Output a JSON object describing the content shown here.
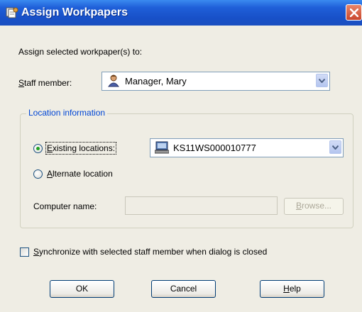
{
  "window": {
    "title": "Assign Workpapers",
    "icons": {
      "title": "workpapers-icon",
      "close": "close-icon"
    },
    "colors": {
      "titlebar": "#1f5fd8",
      "close": "#c9462c",
      "group_title": "#0046d5"
    }
  },
  "assign": {
    "instruction": "Assign selected workpaper(s) to:"
  },
  "staff": {
    "label_key": "S",
    "label_rest": "taff member:",
    "value": "Manager, Mary",
    "icon": "person-icon"
  },
  "location": {
    "group_title": "Location information",
    "existing": {
      "label_key": "E",
      "label_rest": "xisting locations:",
      "selected": true
    },
    "existing_combo": {
      "value": "KS11WS000010777",
      "icon": "computer-icon"
    },
    "alternate": {
      "label_key": "A",
      "label_rest": "lternate location",
      "selected": false
    },
    "computer_name": {
      "label": "Computer name:",
      "value": ""
    },
    "browse": {
      "label_key": "B",
      "label_rest": "rowse...",
      "enabled": false
    }
  },
  "sync": {
    "label_key": "S",
    "label_rest": "ynchronize with selected staff member when dialog is closed",
    "checked": false
  },
  "buttons": {
    "ok": "OK",
    "cancel": "Cancel",
    "help_key": "H",
    "help_rest": "elp"
  }
}
